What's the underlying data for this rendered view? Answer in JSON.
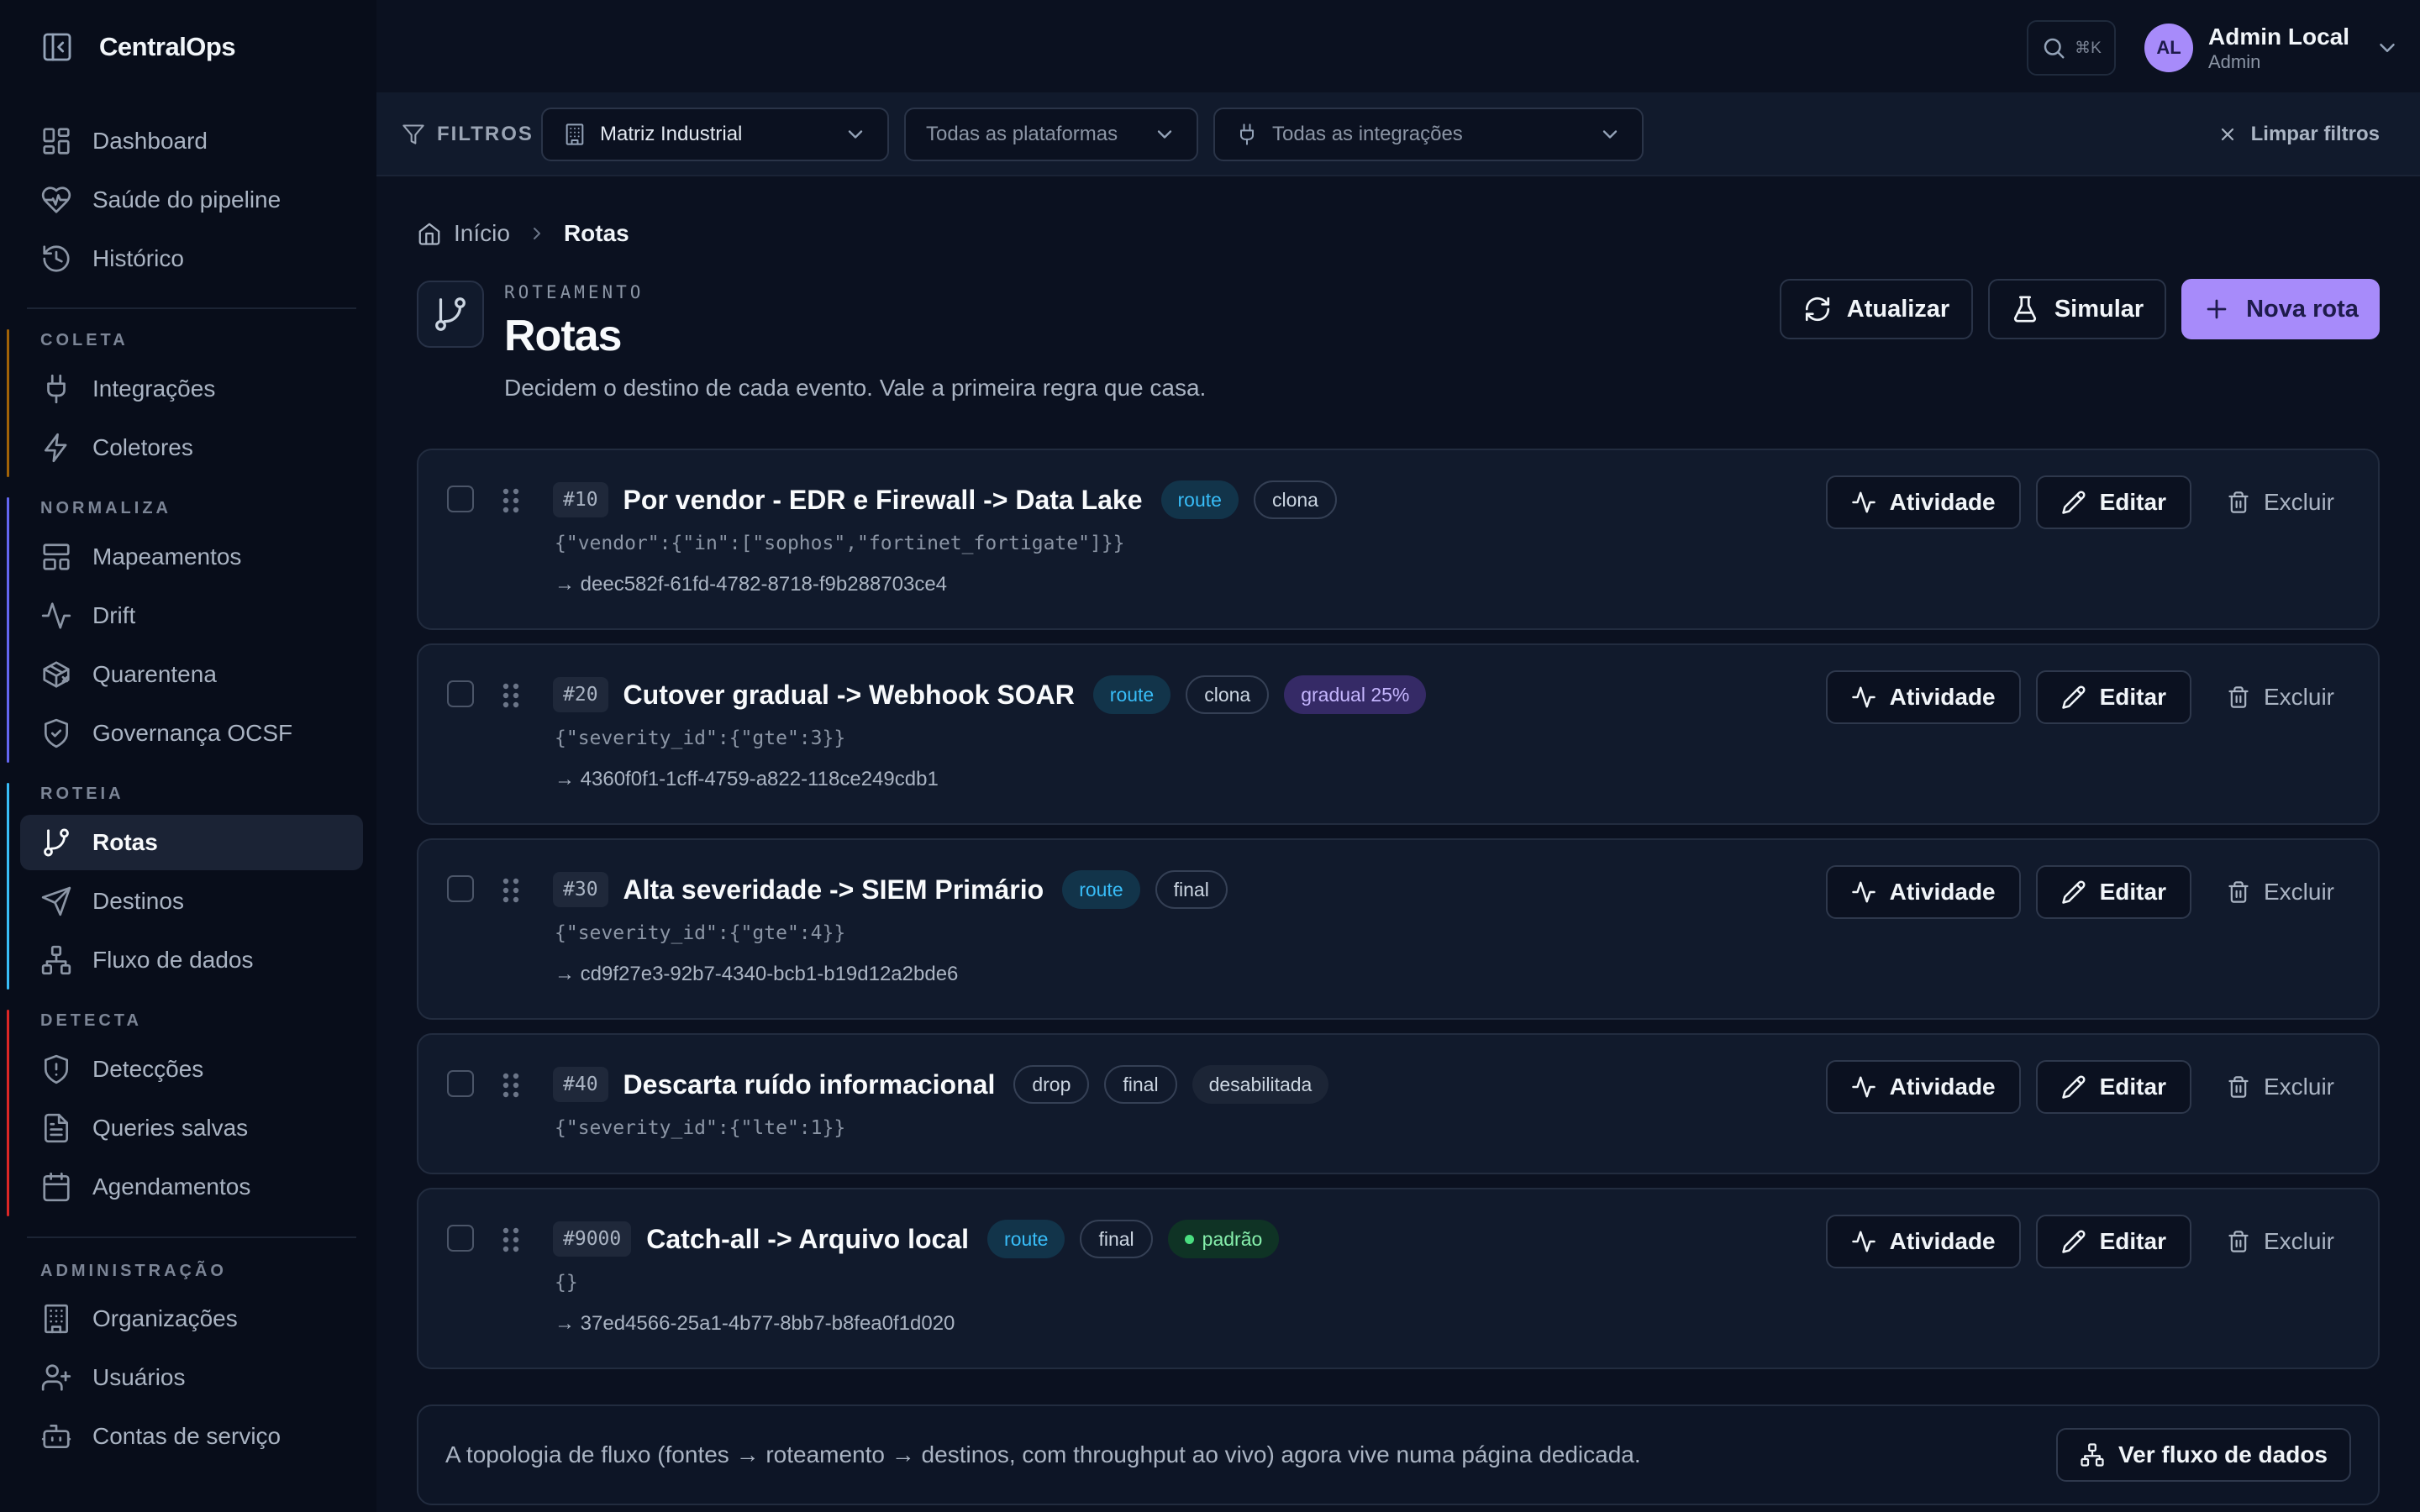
{
  "app": {
    "name": "CentralOps"
  },
  "nav": {
    "top": [
      {
        "label": "Dashboard",
        "icon": "dashboard-icon"
      },
      {
        "label": "Saúde do pipeline",
        "icon": "heart-pulse-icon"
      },
      {
        "label": "Histórico",
        "icon": "history-icon"
      }
    ],
    "groups": [
      {
        "label": "COLETA",
        "color": "#a16207",
        "items": [
          {
            "label": "Integrações",
            "icon": "plug-icon"
          },
          {
            "label": "Coletores",
            "icon": "bolt-icon"
          }
        ]
      },
      {
        "label": "NORMALIZA",
        "color": "#6366f1",
        "items": [
          {
            "label": "Mapeamentos",
            "icon": "layout-icon"
          },
          {
            "label": "Drift",
            "icon": "activity-icon"
          },
          {
            "label": "Quarentena",
            "icon": "package-icon"
          },
          {
            "label": "Governança OCSF",
            "icon": "shield-check-icon"
          }
        ]
      },
      {
        "label": "ROTEIA",
        "color": "#38bdf8",
        "items": [
          {
            "label": "Rotas",
            "icon": "git-branch-icon",
            "active": true
          },
          {
            "label": "Destinos",
            "icon": "send-icon"
          },
          {
            "label": "Fluxo de dados",
            "icon": "network-icon"
          }
        ]
      },
      {
        "label": "DETECTA",
        "color": "#dc2626",
        "items": [
          {
            "label": "Detecções",
            "icon": "shield-alert-icon"
          },
          {
            "label": "Queries salvas",
            "icon": "file-text-icon"
          },
          {
            "label": "Agendamentos",
            "icon": "calendar-icon"
          }
        ]
      },
      {
        "label": "ADMINISTRAÇÃO",
        "color": "",
        "items": [
          {
            "label": "Organizações",
            "icon": "building-icon"
          },
          {
            "label": "Usuários",
            "icon": "user-plus-icon"
          },
          {
            "label": "Contas de serviço",
            "icon": "bot-icon"
          }
        ]
      }
    ]
  },
  "search": {
    "shortcut": "⌘K"
  },
  "user": {
    "initials": "AL",
    "name": "Admin Local",
    "role": "Admin"
  },
  "filters": {
    "label": "FILTROS",
    "org": "Matriz Industrial",
    "platform": "Todas as plataformas",
    "integration": "Todas as integrações",
    "clear": "Limpar filtros"
  },
  "breadcrumb": {
    "home": "Início",
    "current": "Rotas"
  },
  "header": {
    "eyebrow": "ROTEAMENTO",
    "title": "Rotas",
    "subtitle": "Decidem o destino de cada evento. Vale a primeira regra que casa.",
    "refresh": "Atualizar",
    "simulate": "Simular",
    "new_route": "Nova rota"
  },
  "actions": {
    "activity": "Atividade",
    "edit": "Editar",
    "delete": "Excluir"
  },
  "routes": [
    {
      "priority": "#10",
      "name": "Por vendor - EDR e Firewall -> Data Lake",
      "badges": [
        {
          "text": "route",
          "kind": "route"
        },
        {
          "text": "clona",
          "kind": "outline"
        }
      ],
      "condition": "{\"vendor\":{\"in\":[\"sophos\",\"fortinet_fortigate\"]}}",
      "destination": "→ deec582f-61fd-4782-8718-f9b288703ce4"
    },
    {
      "priority": "#20",
      "name": "Cutover gradual -> Webhook SOAR",
      "badges": [
        {
          "text": "route",
          "kind": "route"
        },
        {
          "text": "clona",
          "kind": "outline"
        },
        {
          "text": "gradual 25%",
          "kind": "grad"
        }
      ],
      "condition": "{\"severity_id\":{\"gte\":3}}",
      "destination": "→ 4360f0f1-1cff-4759-a822-118ce249cdb1"
    },
    {
      "priority": "#30",
      "name": "Alta severidade -> SIEM Primário",
      "badges": [
        {
          "text": "route",
          "kind": "route"
        },
        {
          "text": "final",
          "kind": "outline"
        }
      ],
      "condition": "{\"severity_id\":{\"gte\":4}}",
      "destination": "→ cd9f27e3-92b7-4340-bcb1-b19d12a2bde6"
    },
    {
      "priority": "#40",
      "name": "Descarta ruído informacional",
      "badges": [
        {
          "text": "drop",
          "kind": "outline"
        },
        {
          "text": "final",
          "kind": "outline"
        },
        {
          "text": "desabilitada",
          "kind": "disabled"
        }
      ],
      "condition": "{\"severity_id\":{\"lte\":1}}",
      "destination": ""
    },
    {
      "priority": "#9000",
      "name": "Catch-all -> Arquivo local",
      "badges": [
        {
          "text": "route",
          "kind": "route"
        },
        {
          "text": "final",
          "kind": "outline"
        },
        {
          "text": "padrão",
          "kind": "default"
        }
      ],
      "condition": "{}",
      "destination": "→ 37ed4566-25a1-4b77-8bb7-b8fea0f1d020"
    }
  ],
  "note": {
    "text": "A topologia de fluxo (fontes → roteamento → destinos, com throughput ao vivo) agora vive numa página dedicada.",
    "button": "Ver fluxo de dados"
  }
}
